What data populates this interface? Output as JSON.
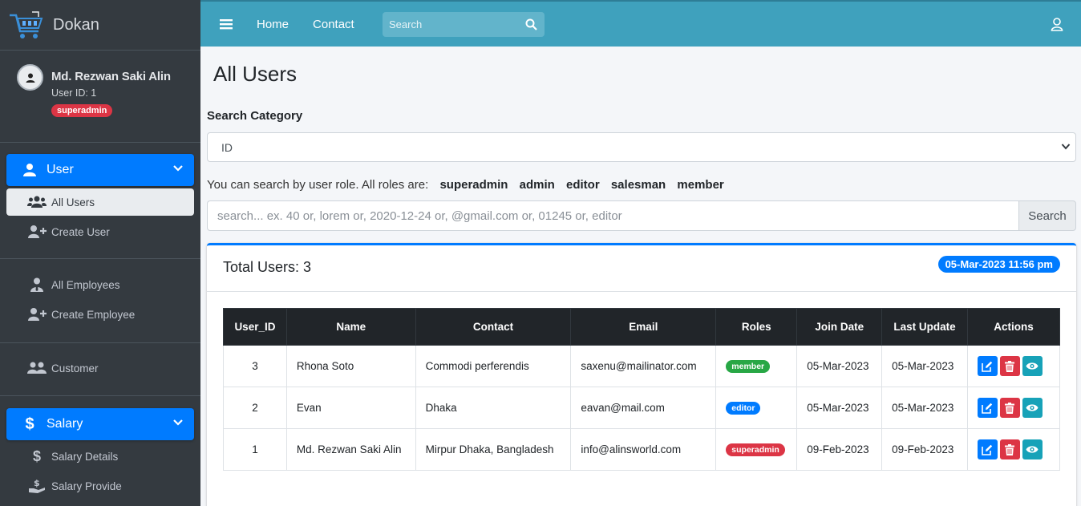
{
  "brand": {
    "name": "Dokan"
  },
  "user_panel": {
    "name": "Md. Rezwan Saki Alin",
    "user_id": "User ID: 1",
    "role": "superadmin"
  },
  "sidebar": {
    "user_section": {
      "label": "User",
      "items": [
        {
          "label": "All Users"
        },
        {
          "label": "Create User"
        }
      ]
    },
    "employee_items": [
      {
        "label": "All Employees"
      },
      {
        "label": "Create Employee"
      }
    ],
    "customer_item": {
      "label": "Customer"
    },
    "salary_section": {
      "label": "Salary",
      "items": [
        {
          "label": "Salary Details"
        },
        {
          "label": "Salary Provide"
        }
      ]
    }
  },
  "topbar": {
    "home": "Home",
    "contact": "Contact",
    "search_placeholder": "Search"
  },
  "page": {
    "title": "All Users",
    "search_category_label": "Search Category",
    "search_category_value": "ID",
    "roles_intro": "You can search by user role. All roles are:",
    "roles": [
      "superadmin",
      "admin",
      "editor",
      "salesman",
      "member"
    ],
    "search_placeholder": "search... ex. 40 or, lorem or, 2020-12-24 or, @gmail.com or, 01245 or, editor",
    "search_button": "Search"
  },
  "card": {
    "title": "Total Users: 3",
    "datetime": "05-Mar-2023 11:56 pm"
  },
  "table": {
    "headers": [
      "User_ID",
      "Name",
      "Contact",
      "Email",
      "Roles",
      "Join Date",
      "Last Update",
      "Actions"
    ],
    "rows": [
      {
        "id": "3",
        "name": "Rhona Soto",
        "contact": "Commodi perferendis",
        "email": "saxenu@mailinator.com",
        "role": "member",
        "join": "05-Mar-2023",
        "update": "05-Mar-2023"
      },
      {
        "id": "2",
        "name": "Evan",
        "contact": "Dhaka",
        "email": "eavan@mail.com",
        "role": "editor",
        "join": "05-Mar-2023",
        "update": "05-Mar-2023"
      },
      {
        "id": "1",
        "name": "Md. Rezwan Saki Alin",
        "contact": "Mirpur Dhaka, Bangladesh",
        "email": "info@alinsworld.com",
        "role": "superadmin",
        "join": "09-Feb-2023",
        "update": "09-Feb-2023"
      }
    ]
  },
  "colors": {
    "member": "#28a745",
    "editor": "#007bff",
    "superadmin": "#dc3545",
    "edit": "#007bff",
    "delete": "#dc3545",
    "view": "#17a2b8",
    "topbar": "#3fa1bd",
    "sidebar": "#343a40"
  },
  "icons": [
    "cart-logo-icon",
    "avatar-icon",
    "user-icon",
    "chevron-down-icon",
    "users-icon",
    "user-plus-icon",
    "user-tie-icon",
    "user-group-icon",
    "dollar-icon",
    "hand-dollar-icon",
    "hamburger-icon",
    "search-icon",
    "account-icon",
    "edit-icon",
    "trash-icon",
    "eye-icon"
  ]
}
